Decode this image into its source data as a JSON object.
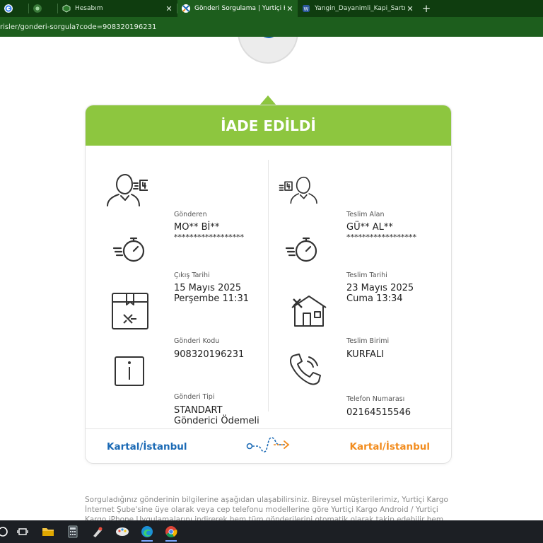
{
  "browser": {
    "tabs": [
      {
        "title": "",
        "favicon": "google-icon",
        "color": "#4285f4"
      },
      {
        "title": "",
        "favicon": "chrome-icon",
        "color": "#3a7a3a"
      },
      {
        "title": "Hesabım",
        "favicon": "yurtici-icon",
        "color": "#2c7a2c",
        "close": "✕"
      },
      {
        "title": "Gönderi Sorgulama | Yurtiçi Kargo",
        "favicon": "yurtici-logo-icon",
        "color": "#ffffff",
        "close": "✕",
        "active": true
      },
      {
        "title": "Yangin_Dayanimli_Kapi_Sartname",
        "favicon": "word-icon",
        "color": "#2b579a",
        "close": "✕"
      }
    ],
    "new_tab": "+",
    "url": "risler/gonderi-sorgula?code=908320196231"
  },
  "status": {
    "title": "İADE EDİLDİ",
    "color": "#8dc63f"
  },
  "sender": {
    "label": "Gönderen",
    "name": "MO** Bİ**",
    "masked": "******************"
  },
  "receiver": {
    "label": "Teslim Alan",
    "name": "GÜ** AL**",
    "masked": "******************"
  },
  "departure": {
    "label": "Çıkış Tarihi",
    "date": "15 Mayıs 2025",
    "time": "Perşembe 11:31"
  },
  "delivery": {
    "label": "Teslim Tarihi",
    "date": "23 Mayıs 2025",
    "time": "Cuma 13:34"
  },
  "shipment_code": {
    "label": "Gönderi Kodu",
    "value": "908320196231"
  },
  "delivery_unit": {
    "label": "Teslim Birimi",
    "value": "KURFALI"
  },
  "shipment_type": {
    "label": "Gönderi Tipi",
    "value": "STANDART",
    "sub": "Gönderici Ödemeli"
  },
  "phone": {
    "label": "Telefon Numarası",
    "value": "02164515546"
  },
  "route": {
    "from": "Kartal/İstanbul",
    "to": "Kartal/İstanbul",
    "from_color": "#1b6ab5",
    "to_color": "#f28c1e"
  },
  "footnote": "Sorguladığınız gönderinin bilgilerine aşağıdan ulaşabilirsiniz. Bireysel müşterilerimiz, Yurtiçi Kargo İnternet Şube'sine üye olarak veya cep telefonu modellerine göre Yurtiçi Kargo Android / Yurtiçi Kargo iPhone Uygulamalarını indirerek hem tüm gönderilerini otomatik olarak takip edebilir hem de adresine kurye çağırma, şube",
  "taskbar": {
    "items": [
      "start-icon",
      "task-view-icon",
      "file-explorer-icon",
      "calculator-icon",
      "paint-icon",
      "snipping-tool-icon",
      "edge-icon",
      "chrome-icon"
    ]
  }
}
